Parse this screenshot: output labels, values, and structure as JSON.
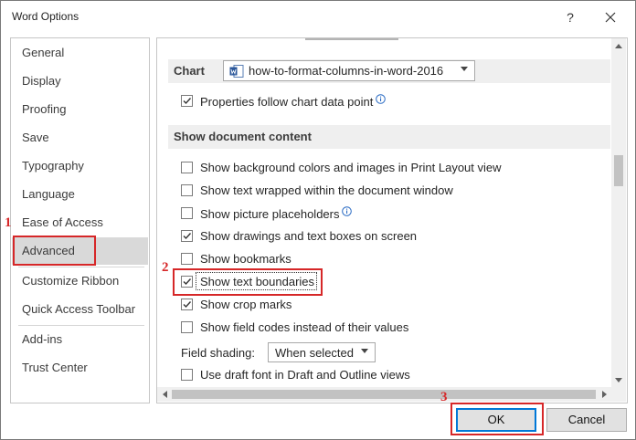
{
  "window": {
    "title": "Word Options"
  },
  "titlebar": {
    "help_glyph": "?"
  },
  "sidebar": {
    "items": [
      {
        "label": "General"
      },
      {
        "label": "Display"
      },
      {
        "label": "Proofing"
      },
      {
        "label": "Save"
      },
      {
        "label": "Typography"
      },
      {
        "label": "Language"
      },
      {
        "label": "Ease of Access"
      },
      {
        "label": "Advanced",
        "selected": true
      },
      {
        "label": "Customize Ribbon"
      },
      {
        "label": "Quick Access Toolbar"
      },
      {
        "label": "Add-ins"
      },
      {
        "label": "Trust Center"
      }
    ]
  },
  "chart_section": {
    "title": "Chart",
    "document": "how-to-format-columns-in-word-2016",
    "properties_follow": {
      "label": "Properties follow chart data point",
      "checked": true
    }
  },
  "show_section": {
    "title": "Show document content",
    "options": [
      {
        "label": "Show background colors and images in Print Layout view",
        "checked": false
      },
      {
        "label": "Show text wrapped within the document window",
        "checked": false
      },
      {
        "label": "Show picture placeholders",
        "checked": false,
        "info": true
      },
      {
        "label": "Show drawings and text boxes on screen",
        "checked": true
      },
      {
        "label": "Show bookmarks",
        "checked": false
      },
      {
        "label": "Show text boundaries",
        "checked": true,
        "focused": true
      },
      {
        "label": "Show crop marks",
        "checked": true
      },
      {
        "label": "Show field codes instead of their values",
        "checked": false
      }
    ],
    "field_shading": {
      "label": "Field shading:",
      "value": "When selected"
    },
    "draft_font": {
      "label": "Use draft font in Draft and Outline views",
      "checked": false
    }
  },
  "footer": {
    "ok_label": "OK",
    "cancel_label": "Cancel"
  },
  "annotations": {
    "color": "#d62728",
    "labels": [
      "1",
      "2",
      "3"
    ]
  }
}
